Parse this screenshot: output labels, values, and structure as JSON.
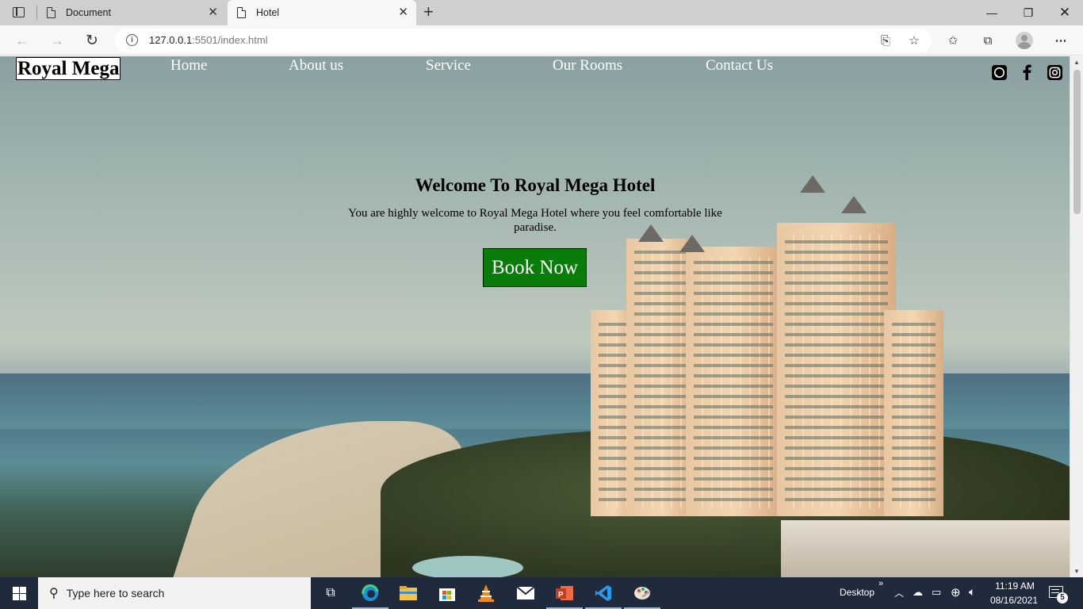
{
  "browser": {
    "tabs": [
      {
        "title": "Document",
        "active": false
      },
      {
        "title": "Hotel",
        "active": true
      }
    ],
    "url": {
      "host": "127.0.0.1",
      "rest": ":5501/index.html"
    }
  },
  "page": {
    "logo": "Royal Mega",
    "nav": [
      "Home",
      "About us",
      "Service",
      "Our Rooms",
      "Contact Us"
    ],
    "social": [
      "whatsapp-icon",
      "facebook-icon",
      "instagram-icon"
    ],
    "hero": {
      "title": "Welcome To Royal Mega Hotel",
      "subtitle": "You are highly welcome to Royal Mega Hotel where you feel comfortable like paradise.",
      "button": "Book Now"
    }
  },
  "taskbar": {
    "search_placeholder": "Type here to search",
    "desktop_label": "Desktop",
    "time": "11:19 AM",
    "date": "08/16/2021",
    "notification_count": "5"
  },
  "colors": {
    "book_button": "#0a7c0a",
    "taskbar": "#1f2a3d"
  }
}
